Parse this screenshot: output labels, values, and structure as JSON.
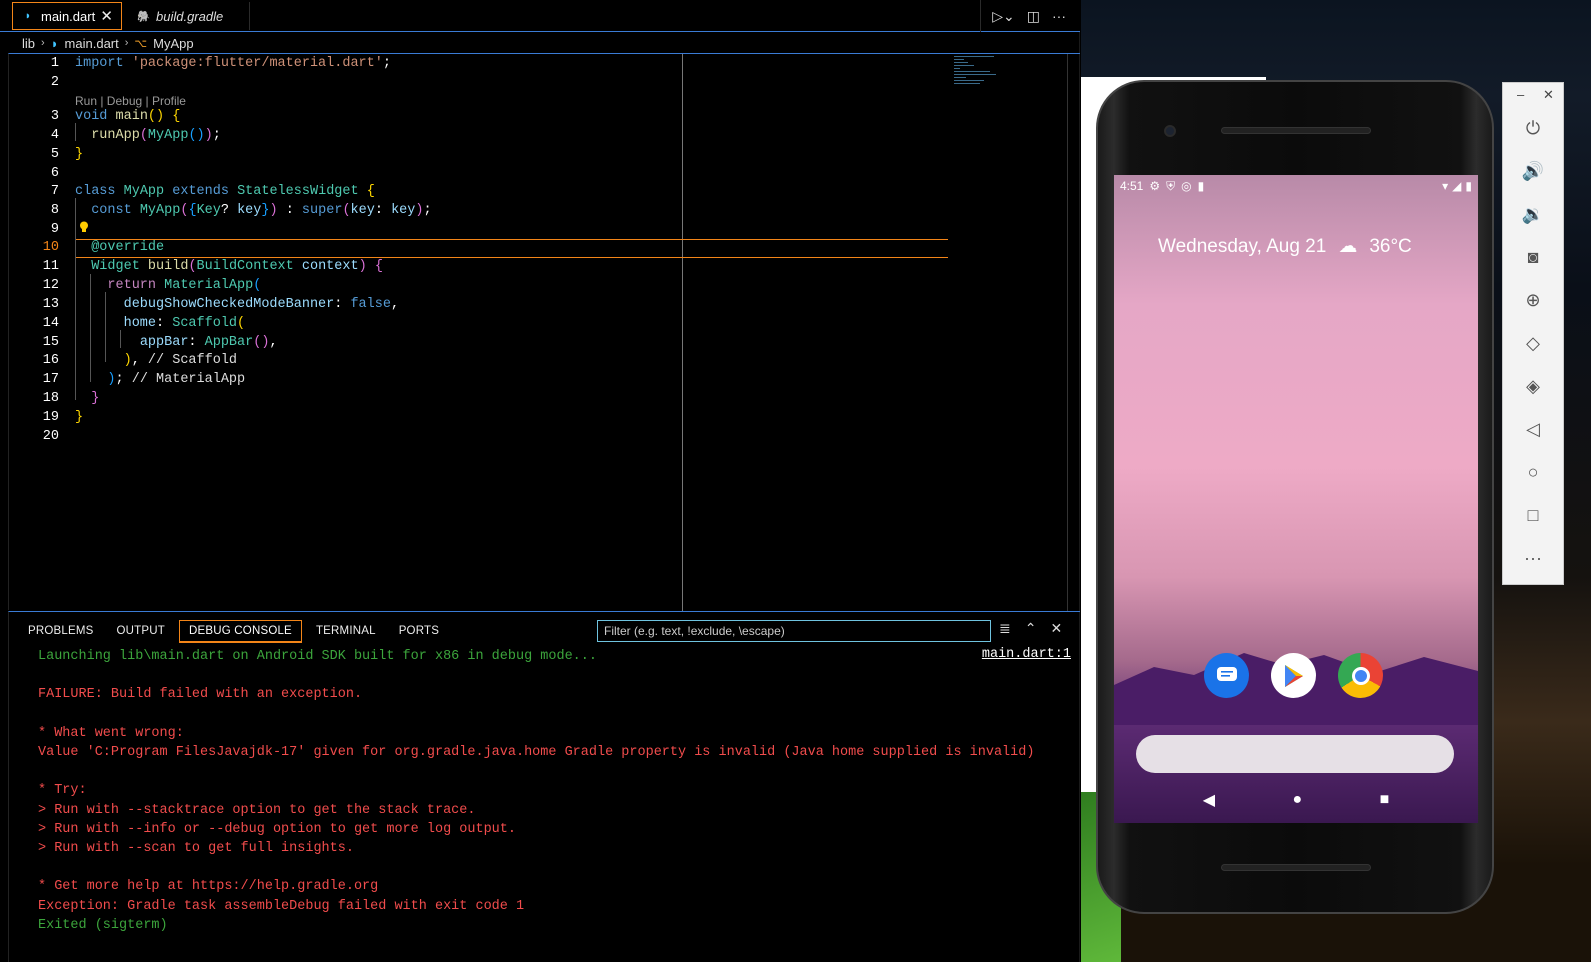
{
  "tabs": [
    {
      "label": "main.dart",
      "icon": "dart-icon",
      "active": true
    },
    {
      "label": "build.gradle",
      "icon": "gradle-icon",
      "active": false
    }
  ],
  "breadcrumb": {
    "folder": "lib",
    "file": "main.dart",
    "symbol": "MyApp"
  },
  "codelens": "Run | Debug | Profile",
  "line_numbers": [
    "1",
    "2",
    "3",
    "4",
    "5",
    "6",
    "7",
    "8",
    "9",
    "10",
    "11",
    "12",
    "13",
    "14",
    "15",
    "16",
    "17",
    "18",
    "19",
    "20"
  ],
  "current_line": "10",
  "panel": {
    "tabs": [
      "PROBLEMS",
      "OUTPUT",
      "DEBUG CONSOLE",
      "TERMINAL",
      "PORTS"
    ],
    "active_tab": "DEBUG CONSOLE",
    "filter_placeholder": "Filter (e.g. text, !exclude, \\escape)",
    "source_link": "main.dart:1",
    "console_lines": [
      {
        "text": "Launching lib\\main.dart on Android SDK built for x86 in debug mode...",
        "color": "#3ca53c"
      },
      {
        "text": "",
        "color": "#f14c4c"
      },
      {
        "text": "FAILURE: Build failed with an exception.",
        "color": "#f14c4c"
      },
      {
        "text": "",
        "color": "#f14c4c"
      },
      {
        "text": "* What went wrong:",
        "color": "#f14c4c"
      },
      {
        "text": "Value 'C:Program FilesJavajdk-17' given for org.gradle.java.home Gradle property is invalid (Java home supplied is invalid)",
        "color": "#f14c4c"
      },
      {
        "text": "",
        "color": "#f14c4c"
      },
      {
        "text": "* Try:",
        "color": "#f14c4c"
      },
      {
        "text": "> Run with --stacktrace option to get the stack trace.",
        "color": "#f14c4c"
      },
      {
        "text": "> Run with --info or --debug option to get more log output.",
        "color": "#f14c4c"
      },
      {
        "text": "> Run with --scan to get full insights.",
        "color": "#f14c4c"
      },
      {
        "text": "",
        "color": "#f14c4c"
      },
      {
        "text": "* Get more help at https://help.gradle.org",
        "color": "#f14c4c"
      },
      {
        "text": "Exception: Gradle task assembleDebug failed with exit code 1",
        "color": "#f14c4c"
      },
      {
        "text": "Exited (sigterm)",
        "color": "#3ca53c"
      }
    ]
  },
  "emulator": {
    "time": "4:51",
    "date": "Wednesday, Aug 21",
    "temperature": "36°C",
    "apps": [
      "messages-icon",
      "play-store-icon",
      "chrome-icon"
    ],
    "toolbar": [
      "power-icon",
      "volume-up-icon",
      "volume-down-icon",
      "camera-icon",
      "zoom-icon",
      "rotate-left-icon",
      "rotate-right-icon",
      "back-icon",
      "home-icon",
      "overview-icon",
      "more-icon"
    ]
  }
}
